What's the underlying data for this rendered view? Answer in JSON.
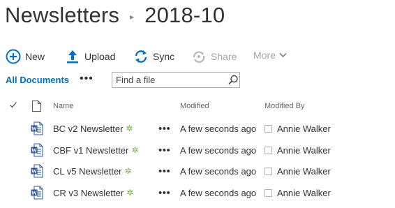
{
  "breadcrumb": {
    "items": [
      "Newsletters",
      "2018-10"
    ],
    "separator": "▸"
  },
  "toolbar": {
    "new_label": "New",
    "upload_label": "Upload",
    "sync_label": "Sync",
    "share_label": "Share",
    "more_label": "More"
  },
  "view": {
    "label": "All Documents",
    "menu_dots": "•••"
  },
  "search": {
    "placeholder": "Find a file"
  },
  "columns": {
    "name": "Name",
    "modified": "Modified",
    "modified_by": "Modified By"
  },
  "rows": [
    {
      "name": "BC v2 Newsletter",
      "modified": "A few seconds ago",
      "modified_by": "Annie Walker"
    },
    {
      "name": "CBF v1 Newsletter",
      "modified": "A few seconds ago",
      "modified_by": "Annie Walker"
    },
    {
      "name": "CL v5 Newsletter",
      "modified": "A few seconds ago",
      "modified_by": "Annie Walker"
    },
    {
      "name": "CR v3 Newsletter",
      "modified": "A few seconds ago",
      "modified_by": "Annie Walker"
    }
  ],
  "row_dots": "•••",
  "new_indicator": "✲",
  "icons": {
    "new": "plus-circle-icon",
    "upload": "upload-arrow-icon",
    "sync": "sync-icon",
    "share": "share-icon",
    "more": "chevron-down-icon",
    "search": "search-icon",
    "file_type": "document-icon",
    "row_file": "word-document-icon",
    "check": "checkmark-icon"
  },
  "colors": {
    "accent": "#0072c6",
    "disabled": "#a6a6a6",
    "new_indicator": "#6fb03b",
    "word_blue": "#2b579a"
  }
}
